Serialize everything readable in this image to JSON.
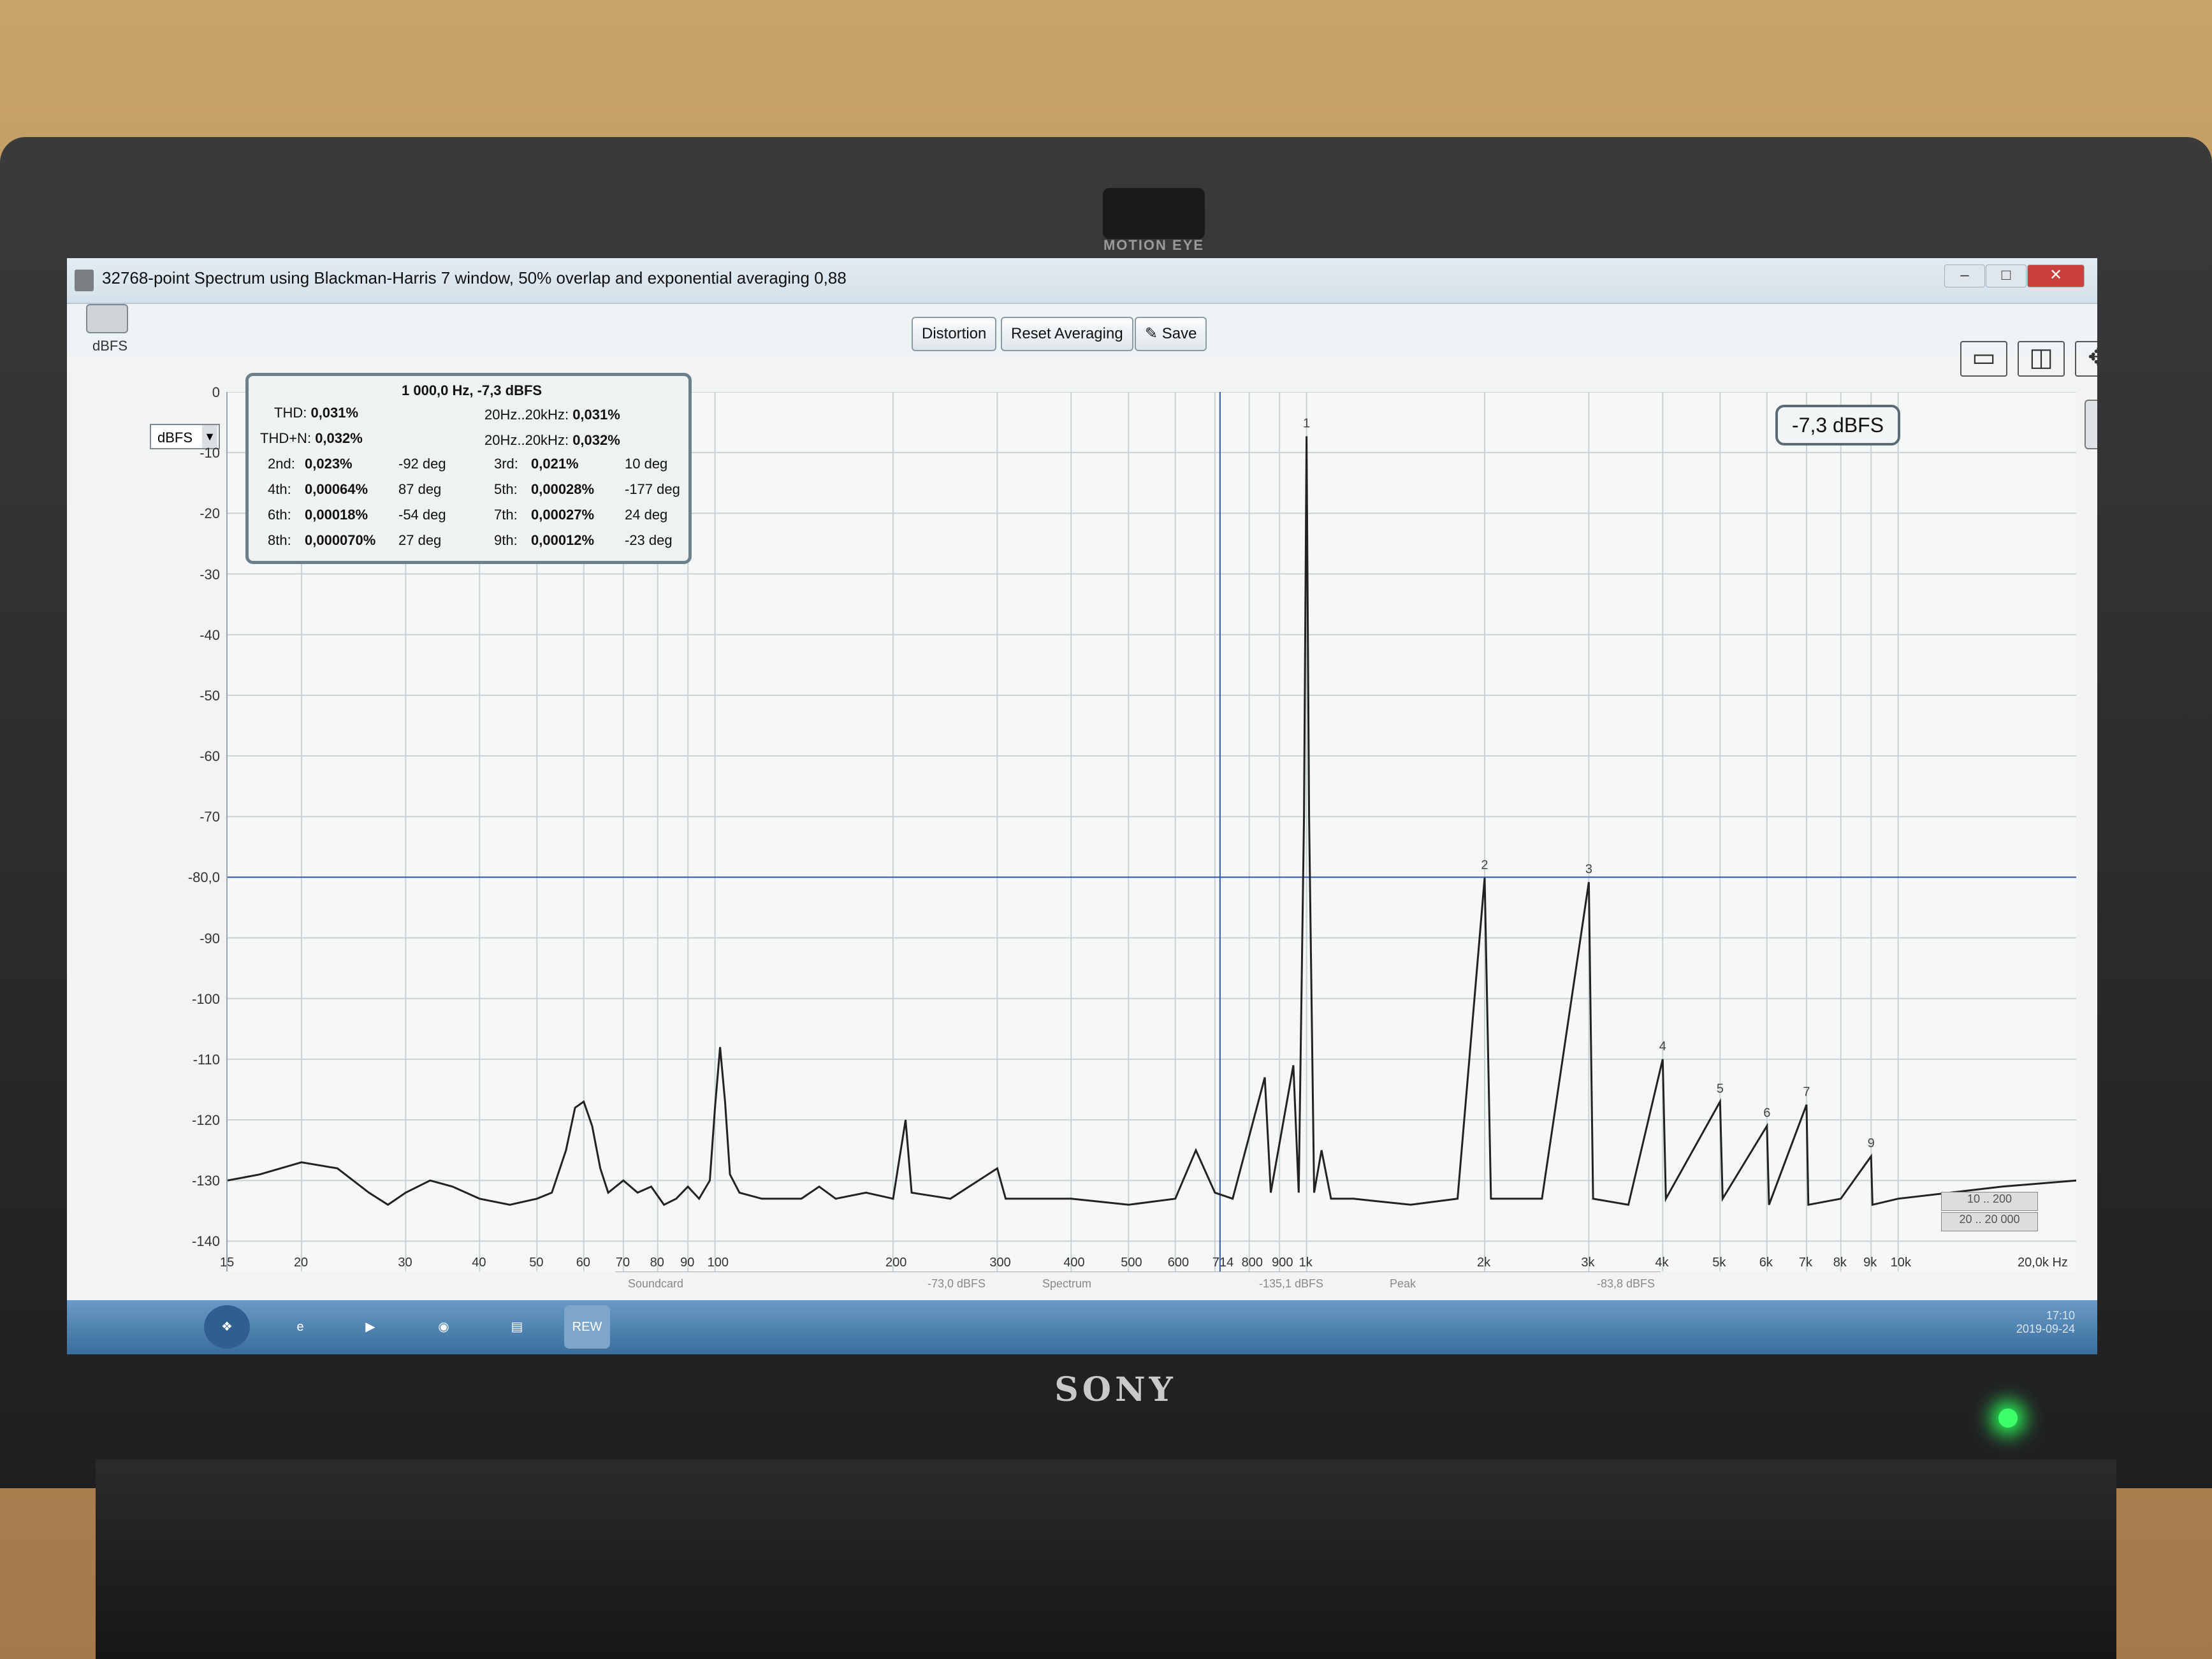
{
  "device": {
    "camera_label": "MOTION EYE",
    "brand": "SONY"
  },
  "window": {
    "title": "32768-point Spectrum using Blackman-Harris 7 window, 50% overlap and exponential averaging 0,88"
  },
  "toolbar": {
    "distortion_label": "Distortion",
    "reset_label": "Reset Averaging",
    "save_label": "Save"
  },
  "y_axis": {
    "unit": "dBFS",
    "ticks": [
      "0",
      "-10",
      "-20",
      "-30",
      "-40",
      "-50",
      "-60",
      "-70",
      "-80,0",
      "-90",
      "-100",
      "-110",
      "-120",
      "-130",
      "-140"
    ]
  },
  "unit_selector": {
    "value": "dBFS"
  },
  "x_axis": {
    "ticks": [
      "15",
      "20",
      "30",
      "40",
      "50",
      "60",
      "70",
      "80",
      "90",
      "100",
      "200",
      "300",
      "400",
      "500",
      "600",
      "714",
      "800",
      "900",
      "1k",
      "2k",
      "3k",
      "4k",
      "5k",
      "6k",
      "7k",
      "8k",
      "9k",
      "10k",
      "20,0k Hz"
    ]
  },
  "distortion_panel": {
    "header": "1 000,0 Hz, -7,3 dBFS",
    "thd_label": "THD:",
    "thd_value": "0,031%",
    "thd_band_label": "20Hz..20kHz:",
    "thd_band_value": "0,031%",
    "thdn_label": "THD+N:",
    "thdn_value": "0,032%",
    "thdn_band_label": "20Hz..20kHz:",
    "thdn_band_value": "0,032%",
    "harmonics": [
      {
        "label": "2nd:",
        "value": "0,023%",
        "phase": "-92 deg"
      },
      {
        "label": "3rd:",
        "value": "0,021%",
        "phase": "10 deg"
      },
      {
        "label": "4th:",
        "value": "0,00064%",
        "phase": "87 deg"
      },
      {
        "label": "5th:",
        "value": "0,00028%",
        "phase": "-177 deg"
      },
      {
        "label": "6th:",
        "value": "0,00018%",
        "phase": "-54 deg"
      },
      {
        "label": "7th:",
        "value": "0,00027%",
        "phase": "24 deg"
      },
      {
        "label": "8th:",
        "value": "0,000070%",
        "phase": "27 deg"
      },
      {
        "label": "9th:",
        "value": "0,00012%",
        "phase": "-23 deg"
      }
    ]
  },
  "level_badge": "-7,3 dBFS",
  "ranges": [
    "10 .. 200",
    "20 .. 20 000"
  ],
  "legend": {
    "soundcard": "Soundcard",
    "soundcard_value": "-73,0 dBFS",
    "spectrum": "Spectrum",
    "spectrum_value": "-135,1 dBFS",
    "peak": "Peak",
    "peak_value": "-83,8 dBFS"
  },
  "taskbar": {
    "rew_label": "REW",
    "clock_time": "17:10",
    "clock_date": "2019-09-24"
  },
  "colors": {
    "trace": "#222222",
    "cursor": "#3355aa",
    "grid": "#c9d2d6"
  },
  "chart_data": {
    "type": "line",
    "x_scale": "log",
    "xlim": [
      15,
      20000
    ],
    "ylim": [
      -145,
      0
    ],
    "ylabel": "dBFS",
    "cursor": {
      "x": 714,
      "y": -80.0
    },
    "peaks": [
      {
        "label": "1",
        "x": 1000,
        "y": -7.3
      },
      {
        "label": "2",
        "x": 2000,
        "y": -80.1
      },
      {
        "label": "3",
        "x": 3000,
        "y": -80.8
      },
      {
        "label": "4",
        "x": 4000,
        "y": -110.0
      },
      {
        "label": "5",
        "x": 5000,
        "y": -117.0
      },
      {
        "label": "6",
        "x": 6000,
        "y": -121.0
      },
      {
        "label": "7",
        "x": 7000,
        "y": -117.5
      },
      {
        "label": "9",
        "x": 9000,
        "y": -126.0
      }
    ],
    "trace": [
      [
        15,
        -130
      ],
      [
        17,
        -129
      ],
      [
        20,
        -127
      ],
      [
        23,
        -128
      ],
      [
        26,
        -132
      ],
      [
        28,
        -134
      ],
      [
        30,
        -132
      ],
      [
        33,
        -130
      ],
      [
        36,
        -131
      ],
      [
        40,
        -133
      ],
      [
        45,
        -134
      ],
      [
        50,
        -133
      ],
      [
        53,
        -132
      ],
      [
        56,
        -125
      ],
      [
        58,
        -118
      ],
      [
        60,
        -117
      ],
      [
        62,
        -121
      ],
      [
        64,
        -128
      ],
      [
        66,
        -132
      ],
      [
        70,
        -130
      ],
      [
        74,
        -132
      ],
      [
        78,
        -131
      ],
      [
        82,
        -134
      ],
      [
        86,
        -133
      ],
      [
        90,
        -131
      ],
      [
        94,
        -133
      ],
      [
        98,
        -130
      ],
      [
        100,
        -118
      ],
      [
        102,
        -108
      ],
      [
        104,
        -117
      ],
      [
        106,
        -129
      ],
      [
        110,
        -132
      ],
      [
        120,
        -133
      ],
      [
        140,
        -133
      ],
      [
        150,
        -131
      ],
      [
        160,
        -133
      ],
      [
        180,
        -132
      ],
      [
        200,
        -133
      ],
      [
        210,
        -120
      ],
      [
        215,
        -132
      ],
      [
        250,
        -133
      ],
      [
        300,
        -128
      ],
      [
        310,
        -133
      ],
      [
        400,
        -133
      ],
      [
        500,
        -134
      ],
      [
        600,
        -133
      ],
      [
        650,
        -125
      ],
      [
        700,
        -132
      ],
      [
        750,
        -133
      ],
      [
        850,
        -113
      ],
      [
        870,
        -132
      ],
      [
        950,
        -111
      ],
      [
        970,
        -132
      ],
      [
        990,
        -70
      ],
      [
        1000,
        -7.3
      ],
      [
        1010,
        -70
      ],
      [
        1030,
        -132
      ],
      [
        1060,
        -125
      ],
      [
        1100,
        -133
      ],
      [
        1200,
        -133
      ],
      [
        1500,
        -134
      ],
      [
        1800,
        -133
      ],
      [
        2000,
        -80.1
      ],
      [
        2050,
        -133
      ],
      [
        2500,
        -133
      ],
      [
        3000,
        -80.8
      ],
      [
        3050,
        -133
      ],
      [
        3500,
        -134
      ],
      [
        4000,
        -110
      ],
      [
        4050,
        -133
      ],
      [
        5000,
        -117
      ],
      [
        5050,
        -133
      ],
      [
        6000,
        -121
      ],
      [
        6050,
        -134
      ],
      [
        7000,
        -117.5
      ],
      [
        7050,
        -134
      ],
      [
        8000,
        -133
      ],
      [
        9000,
        -126
      ],
      [
        9050,
        -134
      ],
      [
        10000,
        -133
      ],
      [
        15000,
        -131
      ],
      [
        20000,
        -130
      ]
    ]
  }
}
